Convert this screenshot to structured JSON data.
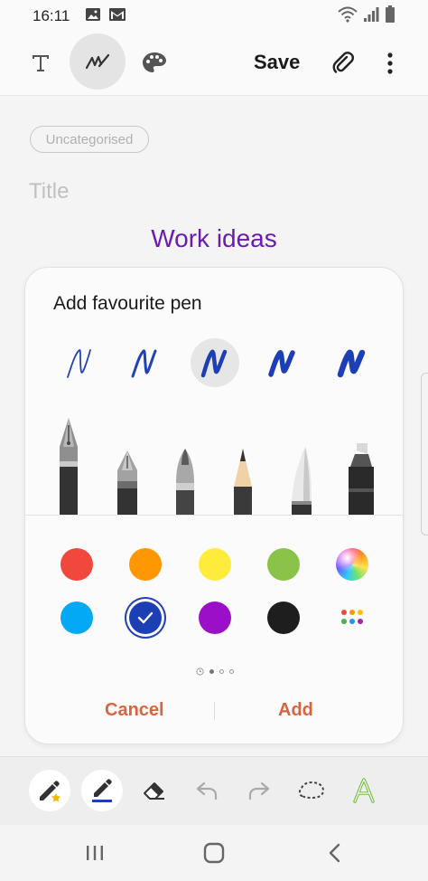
{
  "status_bar": {
    "time": "16:11",
    "left_icons": [
      "image-icon",
      "gmail-icon"
    ],
    "right_icons": [
      "wifi-icon",
      "signal-icon",
      "battery-icon"
    ]
  },
  "toolbar": {
    "text_tool_icon": "text-icon",
    "pen_tool_icon": "pen-icon",
    "palette_tool_icon": "palette-icon",
    "save_label": "Save",
    "attach_icon": "paperclip-icon",
    "more_icon": "more-vertical-icon"
  },
  "note": {
    "category": "Uncategorised",
    "title_placeholder": "Title",
    "heading": "Work ideas"
  },
  "pen_panel": {
    "title": "Add favourite pen",
    "pen_styles": [
      {
        "name": "thin-stroke"
      },
      {
        "name": "medium-stroke"
      },
      {
        "name": "bold-stroke",
        "selected": true
      },
      {
        "name": "heavy-stroke"
      },
      {
        "name": "marker-stroke"
      }
    ],
    "pen_tools": [
      "fountain-pen",
      "calligraphy-pen",
      "brush-pen",
      "pencil",
      "chisel-pen",
      "marker"
    ],
    "colors": [
      {
        "hex": "#f2473c"
      },
      {
        "hex": "#ff9800"
      },
      {
        "hex": "#ffeb3b"
      },
      {
        "hex": "#8bc34a"
      },
      {
        "hex": "spectrum"
      },
      {
        "hex": "#03a9f4"
      },
      {
        "hex": "#1d3fb6",
        "selected": true
      },
      {
        "hex": "#9c0fc9"
      },
      {
        "hex": "#1e1e1e"
      },
      {
        "hex": "more"
      }
    ],
    "cancel_label": "Cancel",
    "add_label": "Add",
    "accent_color": "#d9643e"
  },
  "bottom_tools": [
    "favourite-pen-icon",
    "pen-settings-icon",
    "eraser-icon",
    "undo-icon",
    "redo-icon",
    "lasso-icon",
    "handwriting-icon"
  ],
  "nav": [
    "recent-apps-icon",
    "home-icon",
    "back-icon"
  ]
}
